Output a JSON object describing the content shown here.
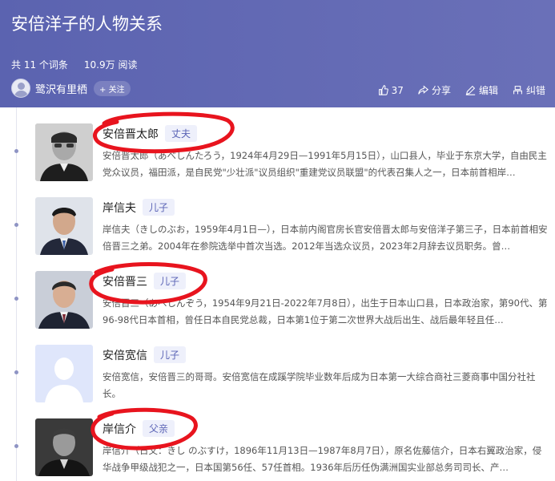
{
  "page": {
    "title": "安倍洋子的人物关系",
    "stats": {
      "count_text": "共 11 个词条",
      "views_text": "10.9万 阅读"
    },
    "author": {
      "name": "鹭沢有里栖",
      "follow_label": "+ 关注"
    },
    "actions": {
      "like_count": "37",
      "share_label": "分享",
      "edit_label": "编辑",
      "report_label": "纠错"
    }
  },
  "items": [
    {
      "name": "安倍晋太郎",
      "relation": "丈夫",
      "desc": "安倍晋太郎（あべしんたろう，1924年4月29日—1991年5月15日），山口县人，毕业于东京大学，自由民主党众议员，福田派，是自民党\"少壮派\"议员组织\"重建党议员联盟\"的代表召集人之一，日本前首相岸…"
    },
    {
      "name": "岸信夫",
      "relation": "儿子",
      "desc": "岸信夫（きしのぶお，1959年4月1日—），日本前内阁官房长官安倍晋太郎与安倍洋子第三子，日本前首相安倍晋三之弟。2004年在参院选举中首次当选。2012年当选众议员，2023年2月辞去议员职务。曾…"
    },
    {
      "name": "安倍晋三",
      "relation": "儿子",
      "desc": "安倍晋三（あべしんぞう，1954年9月21日-2022年7月8日），出生于日本山口县，日本政治家，第90代、第96-98代日本首相，曾任日本自民党总裁，日本第1位于第二次世界大战后出生、战后最年轻且任…"
    },
    {
      "name": "安倍宽信",
      "relation": "儿子",
      "desc": "安倍宽信，安倍晋三的哥哥。安倍宽信在成蹊学院毕业数年后成为日本第一大综合商社三菱商事中国分社社长。"
    },
    {
      "name": "岸信介",
      "relation": "父亲",
      "desc": "岸信介（日文：きし のぶすけ，1896年11月13日—1987年8月7日），原名佐藤信介，日本右翼政治家，侵华战争甲级战犯之一，日本国第56任、57任首相。1936年后历任伪满洲国实业部总务司司长、产…"
    }
  ],
  "colors": {
    "header_bg": "#5b63b0",
    "tag_bg": "#eef0fb",
    "tag_text": "#5a63b5",
    "annotation": "#e8141e"
  }
}
